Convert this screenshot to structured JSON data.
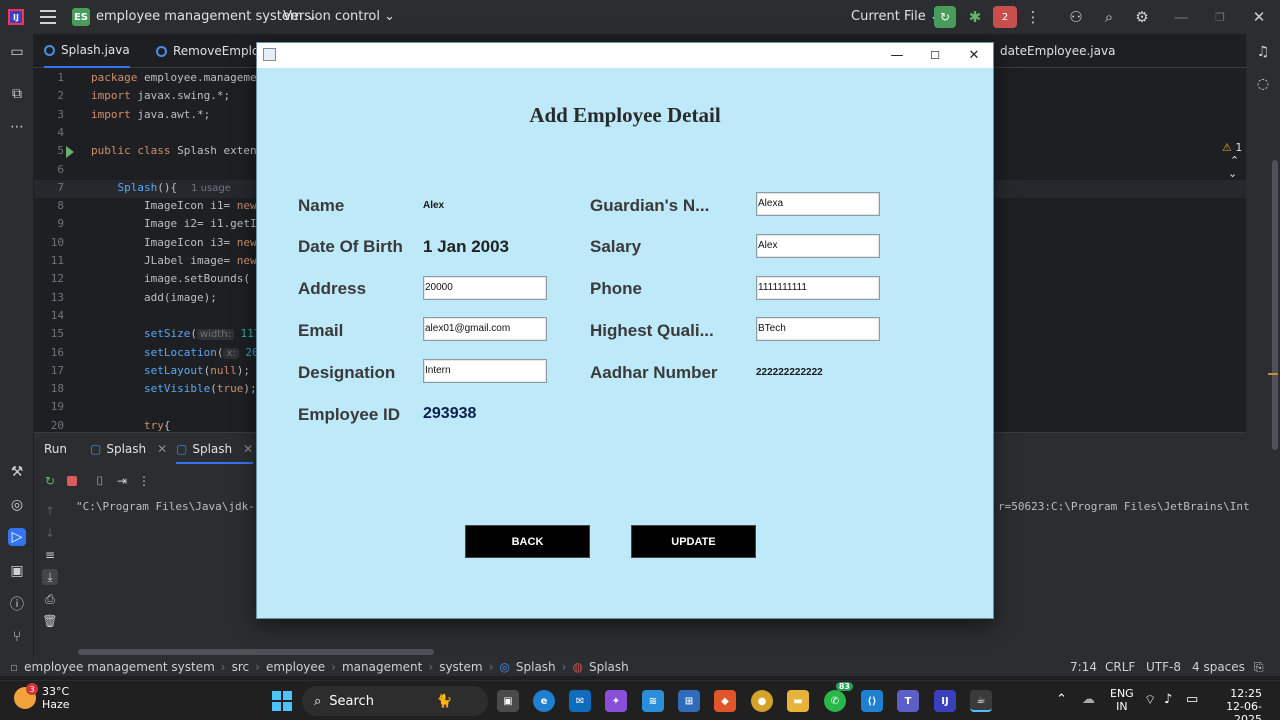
{
  "ide": {
    "logo": "IJ",
    "project_badge": "ES",
    "project_name": "employee management system",
    "vcs": "Version control",
    "current_file": "Current File",
    "notification_count": "2"
  },
  "editor_tabs": [
    {
      "label": "Splash.java"
    },
    {
      "label": "RemoveEmploye"
    },
    {
      "label": "dateEmployee.java"
    }
  ],
  "editor": {
    "warning_count": "1",
    "lines": [
      {
        "n": "1",
        "code": "package employee.manageme"
      },
      {
        "n": "2",
        "code": "import javax.swing.*;"
      },
      {
        "n": "3",
        "code": "import java.awt.*;"
      },
      {
        "n": "4",
        "code": ""
      },
      {
        "n": "5",
        "code": "public class Splash exten"
      },
      {
        "n": "6",
        "code": ""
      },
      {
        "n": "7",
        "code": "    Splash(){"
      },
      {
        "n": "8",
        "code": "        ImageIcon i1= new"
      },
      {
        "n": "9",
        "code": "        Image i2= i1.getI"
      },
      {
        "n": "10",
        "code": "        ImageIcon i3= new"
      },
      {
        "n": "11",
        "code": "        JLabel image= new"
      },
      {
        "n": "12",
        "code": "        image.setBounds("
      },
      {
        "n": "13",
        "code": "        add(image);"
      },
      {
        "n": "14",
        "code": ""
      },
      {
        "n": "15",
        "code": "        setSize("
      },
      {
        "n": "16",
        "code": "        setLocation("
      },
      {
        "n": "17",
        "code": "        setLayout(null);"
      },
      {
        "n": "18",
        "code": "        setVisible(true);"
      },
      {
        "n": "19",
        "code": ""
      },
      {
        "n": "20",
        "code": "        try{"
      }
    ],
    "usage_hint": "1 usage",
    "hint_width": "width:",
    "hint_width_val": "117",
    "hint_x": "x:",
    "hint_x_val": "20"
  },
  "run_panel": {
    "title": "Run",
    "tabs": [
      {
        "label": "Splash"
      },
      {
        "label": "Splash"
      }
    ],
    "console_left": "\"C:\\Program Files\\Java\\jdk-",
    "console_right": "r=50623:C:\\Program Files\\JetBrains\\Int"
  },
  "statusbar": {
    "crumbs": [
      "employee management system",
      "src",
      "employee",
      "management",
      "system",
      "Splash",
      "Splash"
    ],
    "position": "7:14",
    "line_sep": "CRLF",
    "encoding": "UTF-8",
    "indent": "4 spaces"
  },
  "dialog": {
    "heading": "Add Employee Detail",
    "labels": {
      "name": "Name",
      "dob": "Date Of Birth",
      "address": "Address",
      "email": "Email",
      "designation": "Designation",
      "empid": "Employee ID",
      "guardian": "Guardian's N...",
      "salary": "Salary",
      "phone": "Phone",
      "qualification": "Highest Quali...",
      "aadhar": "Aadhar Number"
    },
    "values": {
      "name": "Alex",
      "dob": "1 Jan 2003",
      "address": "20000",
      "email": "alex01@gmail.com",
      "designation": "Intern",
      "empid": "293938",
      "guardian": "Alexa",
      "salary": "Alex",
      "phone": "1111111111",
      "qualification": "BTech",
      "aadhar": "222222222222"
    },
    "back_label": "BACK",
    "update_label": "UPDATE"
  },
  "taskbar": {
    "weather_badge": "3",
    "temperature": "33°C",
    "condition": "Haze",
    "search_label": "Search",
    "whatsapp_count": "83",
    "lang_top": "ENG",
    "lang_bottom": "IN",
    "time": "12:25",
    "date": "12-06-2025"
  }
}
